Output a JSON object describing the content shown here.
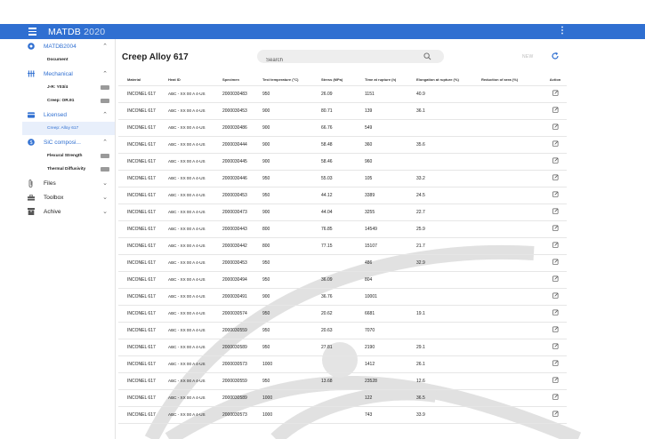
{
  "app": {
    "name": "MATDB",
    "year": "2020"
  },
  "sidebar": {
    "groups": [
      {
        "label": "MATDB2004",
        "icon": "logo-icon",
        "items": [
          {
            "label": "Document",
            "tag": false,
            "active": false
          }
        ]
      },
      {
        "label": "Mechanical",
        "icon": "bars-icon",
        "items": [
          {
            "label": "J-R: Y03/4",
            "tag": true,
            "active": false
          },
          {
            "label": "Creep: OR.91",
            "tag": true,
            "active": false
          }
        ]
      },
      {
        "label": "Licensed",
        "icon": "card-icon",
        "items": [
          {
            "label": "Creep: Alloy 617",
            "tag": false,
            "active": true
          }
        ]
      },
      {
        "label": "SiC composi...",
        "icon": "dollar-icon",
        "items": [
          {
            "label": "Flexural Strength",
            "tag": true,
            "active": false
          },
          {
            "label": "Thermal Diffusivity",
            "tag": true,
            "active": false
          }
        ]
      },
      {
        "label": "Files",
        "icon": "clip-icon",
        "items": []
      },
      {
        "label": "Toolbox",
        "icon": "toolbox-icon",
        "items": []
      },
      {
        "label": "Achive",
        "icon": "archive-icon",
        "items": []
      }
    ]
  },
  "main": {
    "title": "Creep Alloy 617",
    "search_placeholder": "Search",
    "new_label": "NEW",
    "columns": [
      "Material",
      "Heat ID",
      "Specimen",
      "Test temperature (°C)",
      "Stress (MPa)",
      "Time at rupture (h)",
      "Elongation at rupture (%)",
      "Reduction of area (%)",
      "Action"
    ],
    "rows": [
      [
        "INCONEL 617",
        "ABC - XX 00 A 4-US",
        "2000030483",
        "950",
        "26.09",
        "1151",
        "40.9",
        ""
      ],
      [
        "INCONEL 617",
        "ABC - XX 00 A 4-US",
        "2000030453",
        "900",
        "80.71",
        "139",
        "36.1",
        ""
      ],
      [
        "INCONEL 617",
        "ABC - XX 00 A 4-US",
        "2000030486",
        "900",
        "66.76",
        "549",
        "",
        ""
      ],
      [
        "INCONEL 617",
        "ABC - XX 00 A 4-US",
        "2000030444",
        "900",
        "58.48",
        "360",
        "35.6",
        ""
      ],
      [
        "INCONEL 617",
        "ABC - XX 00 A 4-US",
        "2000030445",
        "900",
        "58.46",
        "960",
        "",
        ""
      ],
      [
        "INCONEL 617",
        "ABC - XX 00 A 4-US",
        "2000030446",
        "950",
        "55.03",
        "105",
        "33.2",
        ""
      ],
      [
        "INCONEL 617",
        "ABC - XX 00 A 4-US",
        "2000030453",
        "950",
        "44.12",
        "3389",
        "24.5",
        ""
      ],
      [
        "INCONEL 617",
        "ABC - XX 00 A 4-US",
        "2000030473",
        "900",
        "44.04",
        "3255",
        "22.7",
        ""
      ],
      [
        "INCONEL 617",
        "ABC - XX 00 A 4-US",
        "2000030443",
        "800",
        "76.85",
        "14549",
        "25.9",
        ""
      ],
      [
        "INCONEL 617",
        "ABC - XX 00 A 4-US",
        "2000030442",
        "800",
        "77.15",
        "15107",
        "21.7",
        ""
      ],
      [
        "INCONEL 617",
        "ABC - XX 00 A 4-US",
        "2000030453",
        "950",
        "",
        "486",
        "32.9",
        ""
      ],
      [
        "INCONEL 617",
        "ABC - XX 00 A 4-US",
        "2000030494",
        "950",
        "36.09",
        "804",
        "",
        ""
      ],
      [
        "INCONEL 617",
        "ABC - XX 00 A 4-US",
        "2000030491",
        "900",
        "36.76",
        "10001",
        "",
        ""
      ],
      [
        "INCONEL 617",
        "ABC - XX 00 A 4-US",
        "2000030574",
        "950",
        "20.62",
        "6681",
        "19.1",
        ""
      ],
      [
        "INCONEL 617",
        "ABC - XX 00 A 4-US",
        "2000030559",
        "950",
        "20.63",
        "7070",
        "",
        ""
      ],
      [
        "INCONEL 617",
        "ABC - XX 00 A 4-US",
        "2000030589",
        "950",
        "27.81",
        "2190",
        "29.1",
        ""
      ],
      [
        "INCONEL 617",
        "ABC - XX 00 A 4-US",
        "2000030573",
        "1000",
        "",
        "1412",
        "26.1",
        ""
      ],
      [
        "INCONEL 617",
        "ABC - XX 00 A 4-US",
        "2000030559",
        "950",
        "13.68",
        "23528",
        "12.6",
        ""
      ],
      [
        "INCONEL 617",
        "ABC - XX 00 A 4-US",
        "2000030589",
        "1000",
        "",
        "122",
        "36.5",
        ""
      ],
      [
        "INCONEL 617",
        "ABC - XX 00 A 4-US",
        "2000030573",
        "1000",
        "",
        "743",
        "33.9",
        ""
      ]
    ]
  },
  "colors": {
    "primary": "#2f6fd1",
    "active_bg": "#e8effb"
  }
}
